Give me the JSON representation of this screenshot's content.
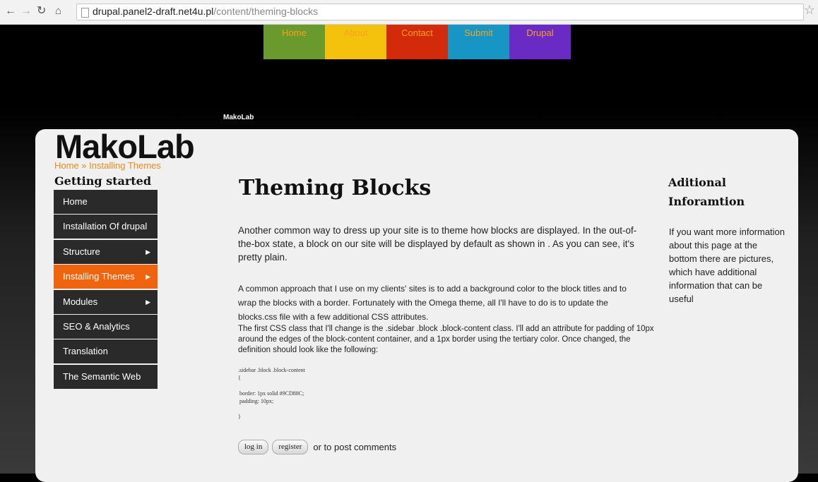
{
  "browser": {
    "url_host": "drupal.panel2-draft.net4u.pl",
    "url_path": "/content/theming-blocks"
  },
  "top_menu": [
    "Home",
    "About",
    "Contact",
    "Submit",
    "Drupal"
  ],
  "site_name_small": "MakoLab",
  "logo": "MakoLab",
  "breadcrumb": {
    "home": "Home",
    "sep": " » ",
    "current": "Installing Themes"
  },
  "sidebar": {
    "title": "Getting started",
    "items": [
      {
        "label": "Home",
        "has_arrow": false,
        "active": false
      },
      {
        "label": "Installation Of drupal",
        "has_arrow": false,
        "active": false
      },
      {
        "label": "Structure",
        "has_arrow": true,
        "active": false
      },
      {
        "label": "Installing Themes",
        "has_arrow": true,
        "active": true
      },
      {
        "label": "Modules",
        "has_arrow": true,
        "active": false
      },
      {
        "label": "SEO & Analytics",
        "has_arrow": false,
        "active": false
      },
      {
        "label": "Translation",
        "has_arrow": false,
        "active": false
      },
      {
        "label": "The Semantic Web",
        "has_arrow": false,
        "active": false
      }
    ]
  },
  "content": {
    "title": "Theming Blocks",
    "p1": "Another common way to dress up your site is to theme how blocks are displayed. In the out-of-the-box state, a block on our site will be displayed by default as shown in . As you can see, it's pretty plain.",
    "p2": "A common approach that I use on my clients' sites is to add a background color to the block titles and to wrap the blocks with a border. Fortunately with the Omega theme, all I'll have to do is to update the blocks.css file with a few additional CSS attributes.",
    "p3": "The first CSS class that I'll change is the .sidebar .block .block-content class. I'll add an attribute for padding of 10px around the edges of the block-content container, and a 1px border using the tertiary color. Once changed, the definition should look like the following:",
    "code": ".sidebar .block .block-content\n{\n\n border: 1px solid #9CD88C;\n padding: 10px;\n\n}",
    "login": "log in",
    "register": "register",
    "comment_suffix": "or to post comments"
  },
  "right": {
    "title": "Aditional Inforamtion",
    "text": "If you want more information about this page at the bottom there are pictures,\nwhich have additional information that can be useful"
  },
  "colors": {
    "home": "#6a9a2e",
    "about": "#f4c20d",
    "contact": "#d42a0c",
    "submit": "#1796c6",
    "drupal": "#6a2bc4",
    "accent": "#f0640e"
  }
}
